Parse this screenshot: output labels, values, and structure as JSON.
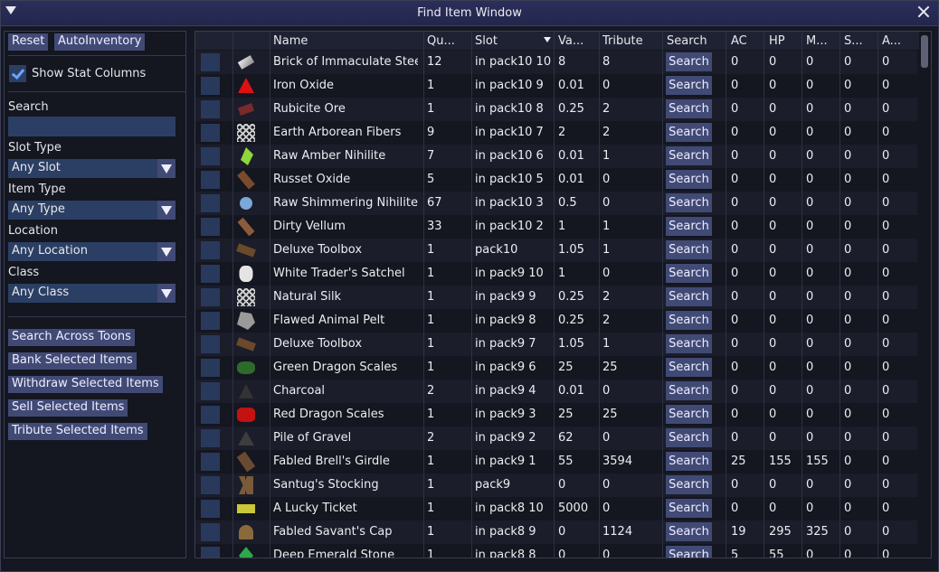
{
  "window": {
    "title": "Find Item Window"
  },
  "left": {
    "reset": "Reset",
    "autoinventory": "AutoInventory",
    "show_stat_columns": "Show Stat Columns",
    "search_label": "Search",
    "search_value": "",
    "slot_type_label": "Slot Type",
    "slot_type_value": "Any Slot",
    "item_type_label": "Item Type",
    "item_type_value": "Any Type",
    "location_label": "Location",
    "location_value": "Any Location",
    "class_label": "Class",
    "class_value": "Any Class",
    "actions": [
      "Search Across Toons",
      "Bank Selected Items",
      "Withdraw Selected Items",
      "Sell Selected Items",
      "Tribute Selected Items"
    ]
  },
  "table": {
    "headers": [
      "Name",
      "Qu...",
      "Slot",
      "Va...",
      "Tribute",
      "Search",
      "AC",
      "HP",
      "M...",
      "S...",
      "A..."
    ],
    "search_button": "Search",
    "rows": [
      {
        "icon": "steel-bar-icon",
        "name": "Brick of Immaculate Steel",
        "qty": "12",
        "slot": "in pack10 10",
        "value": "8",
        "tribute": "8",
        "ac": "0",
        "hp": "0",
        "mana": "0",
        "s": "0",
        "a": "0"
      },
      {
        "icon": "red-pile-icon",
        "name": "Iron Oxide",
        "qty": "1",
        "slot": "in pack10 9",
        "value": "0.01",
        "tribute": "0",
        "ac": "0",
        "hp": "0",
        "mana": "0",
        "s": "0",
        "a": "0"
      },
      {
        "icon": "ore-icon",
        "name": "Rubicite Ore",
        "qty": "1",
        "slot": "in pack10 8",
        "value": "0.25",
        "tribute": "2",
        "ac": "0",
        "hp": "0",
        "mana": "0",
        "s": "0",
        "a": "0"
      },
      {
        "icon": "web-icon",
        "name": "Earth Arborean Fibers",
        "qty": "9",
        "slot": "in pack10 7",
        "value": "2",
        "tribute": "2",
        "ac": "0",
        "hp": "0",
        "mana": "0",
        "s": "0",
        "a": "0"
      },
      {
        "icon": "green-gem-icon",
        "name": "Raw Amber Nihilite",
        "qty": "7",
        "slot": "in pack10 6",
        "value": "0.01",
        "tribute": "1",
        "ac": "0",
        "hp": "0",
        "mana": "0",
        "s": "0",
        "a": "0"
      },
      {
        "icon": "brown-stick-icon",
        "name": "Russet Oxide",
        "qty": "5",
        "slot": "in pack10 5",
        "value": "0.01",
        "tribute": "0",
        "ac": "0",
        "hp": "0",
        "mana": "0",
        "s": "0",
        "a": "0"
      },
      {
        "icon": "blue-gem-icon",
        "name": "Raw Shimmering Nihilite",
        "qty": "67",
        "slot": "in pack10 3",
        "value": "0.5",
        "tribute": "0",
        "ac": "0",
        "hp": "0",
        "mana": "0",
        "s": "0",
        "a": "0"
      },
      {
        "icon": "scroll-icon",
        "name": "Dirty Vellum",
        "qty": "33",
        "slot": "in pack10 2",
        "value": "1",
        "tribute": "1",
        "ac": "0",
        "hp": "0",
        "mana": "0",
        "s": "0",
        "a": "0"
      },
      {
        "icon": "toolbox-icon",
        "name": "Deluxe Toolbox",
        "qty": "1",
        "slot": "pack10",
        "value": "1.05",
        "tribute": "1",
        "ac": "0",
        "hp": "0",
        "mana": "0",
        "s": "0",
        "a": "0"
      },
      {
        "icon": "satchel-icon",
        "name": "White Trader's Satchel",
        "qty": "1",
        "slot": "in pack9 10",
        "value": "1",
        "tribute": "0",
        "ac": "0",
        "hp": "0",
        "mana": "0",
        "s": "0",
        "a": "0"
      },
      {
        "icon": "web-icon",
        "name": "Natural Silk",
        "qty": "1",
        "slot": "in pack9 9",
        "value": "0.25",
        "tribute": "2",
        "ac": "0",
        "hp": "0",
        "mana": "0",
        "s": "0",
        "a": "0"
      },
      {
        "icon": "pelt-icon",
        "name": "Flawed Animal Pelt",
        "qty": "1",
        "slot": "in pack9 8",
        "value": "0.25",
        "tribute": "2",
        "ac": "0",
        "hp": "0",
        "mana": "0",
        "s": "0",
        "a": "0"
      },
      {
        "icon": "toolbox-icon",
        "name": "Deluxe Toolbox",
        "qty": "1",
        "slot": "in pack9 7",
        "value": "1.05",
        "tribute": "1",
        "ac": "0",
        "hp": "0",
        "mana": "0",
        "s": "0",
        "a": "0"
      },
      {
        "icon": "green-scales-icon",
        "name": "Green Dragon Scales",
        "qty": "1",
        "slot": "in pack9 6",
        "value": "25",
        "tribute": "25",
        "ac": "0",
        "hp": "0",
        "mana": "0",
        "s": "0",
        "a": "0"
      },
      {
        "icon": "charcoal-icon",
        "name": "Charcoal",
        "qty": "2",
        "slot": "in pack9 4",
        "value": "0.01",
        "tribute": "0",
        "ac": "0",
        "hp": "0",
        "mana": "0",
        "s": "0",
        "a": "0"
      },
      {
        "icon": "red-scales-icon",
        "name": "Red Dragon Scales",
        "qty": "1",
        "slot": "in pack9 3",
        "value": "25",
        "tribute": "25",
        "ac": "0",
        "hp": "0",
        "mana": "0",
        "s": "0",
        "a": "0"
      },
      {
        "icon": "gravel-icon",
        "name": "Pile of Gravel",
        "qty": "2",
        "slot": "in pack9 2",
        "value": "62",
        "tribute": "0",
        "ac": "0",
        "hp": "0",
        "mana": "0",
        "s": "0",
        "a": "0"
      },
      {
        "icon": "girdle-icon",
        "name": "Fabled Brell's Girdle",
        "qty": "1",
        "slot": "in pack9 1",
        "value": "55",
        "tribute": "3594",
        "ac": "25",
        "hp": "155",
        "mana": "155",
        "s": "0",
        "a": "0"
      },
      {
        "icon": "boots-icon",
        "name": "Santug's Stocking",
        "qty": "1",
        "slot": "pack9",
        "value": "0",
        "tribute": "0",
        "ac": "0",
        "hp": "0",
        "mana": "0",
        "s": "0",
        "a": "0"
      },
      {
        "icon": "ticket-icon",
        "name": "A Lucky Ticket",
        "qty": "1",
        "slot": "in pack8 10",
        "value": "5000",
        "tribute": "0",
        "ac": "0",
        "hp": "0",
        "mana": "0",
        "s": "0",
        "a": "0"
      },
      {
        "icon": "cap-icon",
        "name": "Fabled Savant's Cap",
        "qty": "1",
        "slot": "in pack8 9",
        "value": "0",
        "tribute": "1124",
        "ac": "19",
        "hp": "295",
        "mana": "325",
        "s": "0",
        "a": "0"
      },
      {
        "icon": "emerald-icon",
        "name": "Deep Emerald Stone",
        "qty": "1",
        "slot": "in pack8 8",
        "value": "0",
        "tribute": "0",
        "ac": "5",
        "hp": "55",
        "mana": "0",
        "s": "0",
        "a": "0"
      }
    ]
  },
  "colors": {
    "titlebar": "#2b2e5a",
    "button": "#414a75",
    "input": "#2b3f64",
    "panel": "#141620",
    "accent": "#6da3ff"
  }
}
